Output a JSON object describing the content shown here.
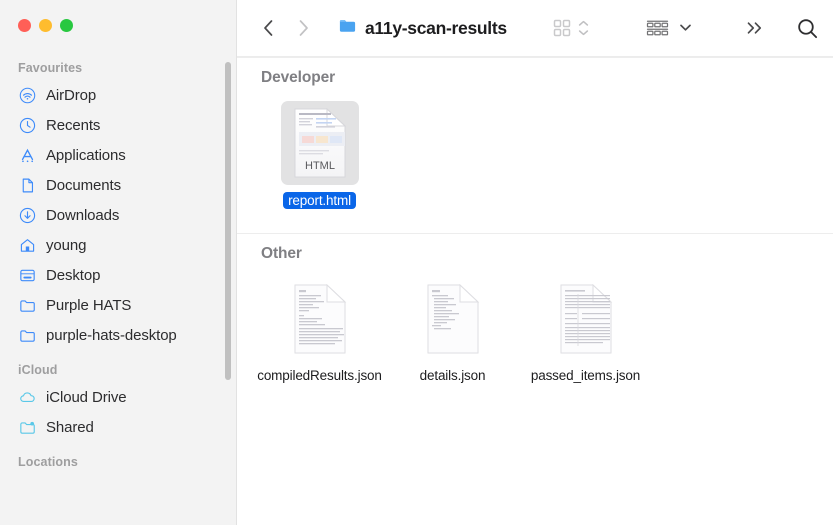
{
  "window": {
    "traffic_lights": [
      {
        "name": "close",
        "color": "#ff5f57"
      },
      {
        "name": "minimize",
        "color": "#febc2e"
      },
      {
        "name": "maximize",
        "color": "#28c840"
      }
    ]
  },
  "toolbar": {
    "back_label": "Back",
    "forward_label": "Forward",
    "folder_title": "a11y-scan-results",
    "view_icon": "grid-view-icon",
    "view_stepper": "up-down-stepper-icon",
    "group_by_icon": "group-by-icon",
    "group_by_chevron": "chevron-down-icon",
    "more_label": "»",
    "search_label": "Search"
  },
  "sidebar": {
    "groups": [
      {
        "title": "Favourites",
        "items": [
          {
            "label": "AirDrop",
            "icon": "airdrop-icon"
          },
          {
            "label": "Recents",
            "icon": "clock-icon"
          },
          {
            "label": "Applications",
            "icon": "applications-icon"
          },
          {
            "label": "Documents",
            "icon": "document-icon"
          },
          {
            "label": "Downloads",
            "icon": "downloads-icon"
          },
          {
            "label": "young",
            "icon": "home-icon"
          },
          {
            "label": "Desktop",
            "icon": "desktop-icon"
          },
          {
            "label": "Purple HATS",
            "icon": "folder-icon"
          },
          {
            "label": "purple-hats-desktop",
            "icon": "folder-icon"
          }
        ]
      },
      {
        "title": "iCloud",
        "items": [
          {
            "label": "iCloud Drive",
            "icon": "cloud-icon"
          },
          {
            "label": "Shared",
            "icon": "shared-folder-icon"
          }
        ]
      },
      {
        "title": "Locations",
        "items": []
      }
    ]
  },
  "content": {
    "sections": [
      {
        "title": "Developer",
        "files": [
          {
            "name": "report.html",
            "kind": "html",
            "selected": true
          }
        ]
      },
      {
        "title": "Other",
        "files": [
          {
            "name": "compiledResults.json",
            "kind": "json",
            "selected": false
          },
          {
            "name": "details.json",
            "kind": "json",
            "selected": false
          },
          {
            "name": "passed_items.json",
            "kind": "json",
            "selected": false
          }
        ]
      }
    ],
    "html_thumb_badge": "HTML"
  },
  "colors": {
    "accent": "#0a66e8",
    "sidebar_bg": "#f3f3f3",
    "sidebar_icon_blue": "#3e8bfa",
    "sidebar_icon_cyan": "#5ac8e8",
    "group_title": "#9e9e9f",
    "section_title": "#7f7f83"
  }
}
